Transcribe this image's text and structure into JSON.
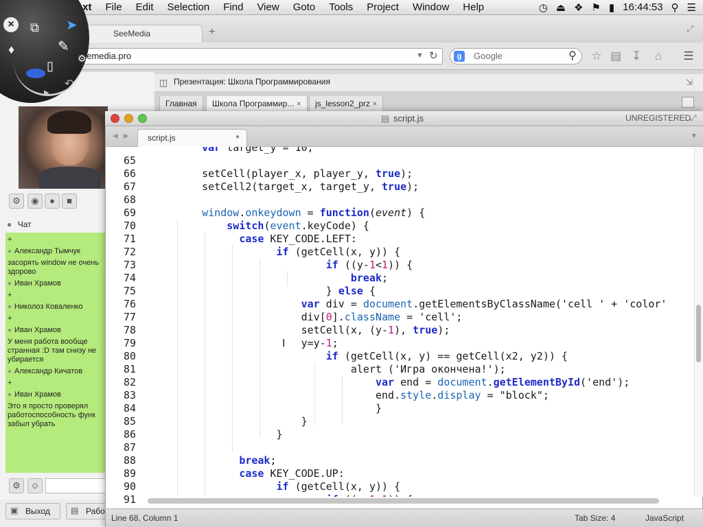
{
  "menubar": {
    "app_name": "Sublime Text",
    "items": [
      "File",
      "Edit",
      "Selection",
      "Find",
      "View",
      "Goto",
      "Tools",
      "Project",
      "Window",
      "Help"
    ],
    "time": "16:44:53"
  },
  "browser": {
    "tab_title": "SeeMedia",
    "url": "eemedia.pro",
    "search_placeholder": "Google",
    "page_title": "Презентация: Школа Программирования",
    "page_tabs": [
      "Главная",
      "Школа Программир...",
      "js_lesson2_prz"
    ]
  },
  "chat": {
    "title": "Чат",
    "entries": [
      {
        "text": "+"
      },
      {
        "name": "Александр Тымчук",
        "text": "засорять window не очень здорово"
      },
      {
        "name": "Иван Храмов",
        "text": "+"
      },
      {
        "name": "Николоз Коваленко",
        "text": "+"
      },
      {
        "name": "Иван Храмов",
        "text": "У меня работа вообще странная :D там снизу не убирается"
      },
      {
        "name": "Александр Кичатов",
        "text": "+"
      },
      {
        "name": "Иван Храмов",
        "text": "Это я просто проверял работоспособность функ забыл убрать"
      }
    ],
    "exit_label": "Выход",
    "work_label": "Рабо"
  },
  "editor": {
    "window_title": "script.js",
    "registration": "UNREGISTERED",
    "tab_label": "script.js",
    "status_left": "Line 68, Column 1",
    "tab_size": "Tab Size: 4",
    "syntax": "JavaScript",
    "line_numbers": [
      "65",
      "66",
      "67",
      "68",
      "69",
      "70",
      "71",
      "72",
      "73",
      "74",
      "75",
      "76",
      "77",
      "78",
      "79",
      "80",
      "81",
      "82",
      "83",
      "84",
      "85",
      "86",
      "87",
      "88",
      "89",
      "90",
      "91"
    ]
  },
  "colors": {
    "chat_bg": "#b5ea7c",
    "keyword": "#1c2bc9",
    "number": "#c3147b"
  }
}
